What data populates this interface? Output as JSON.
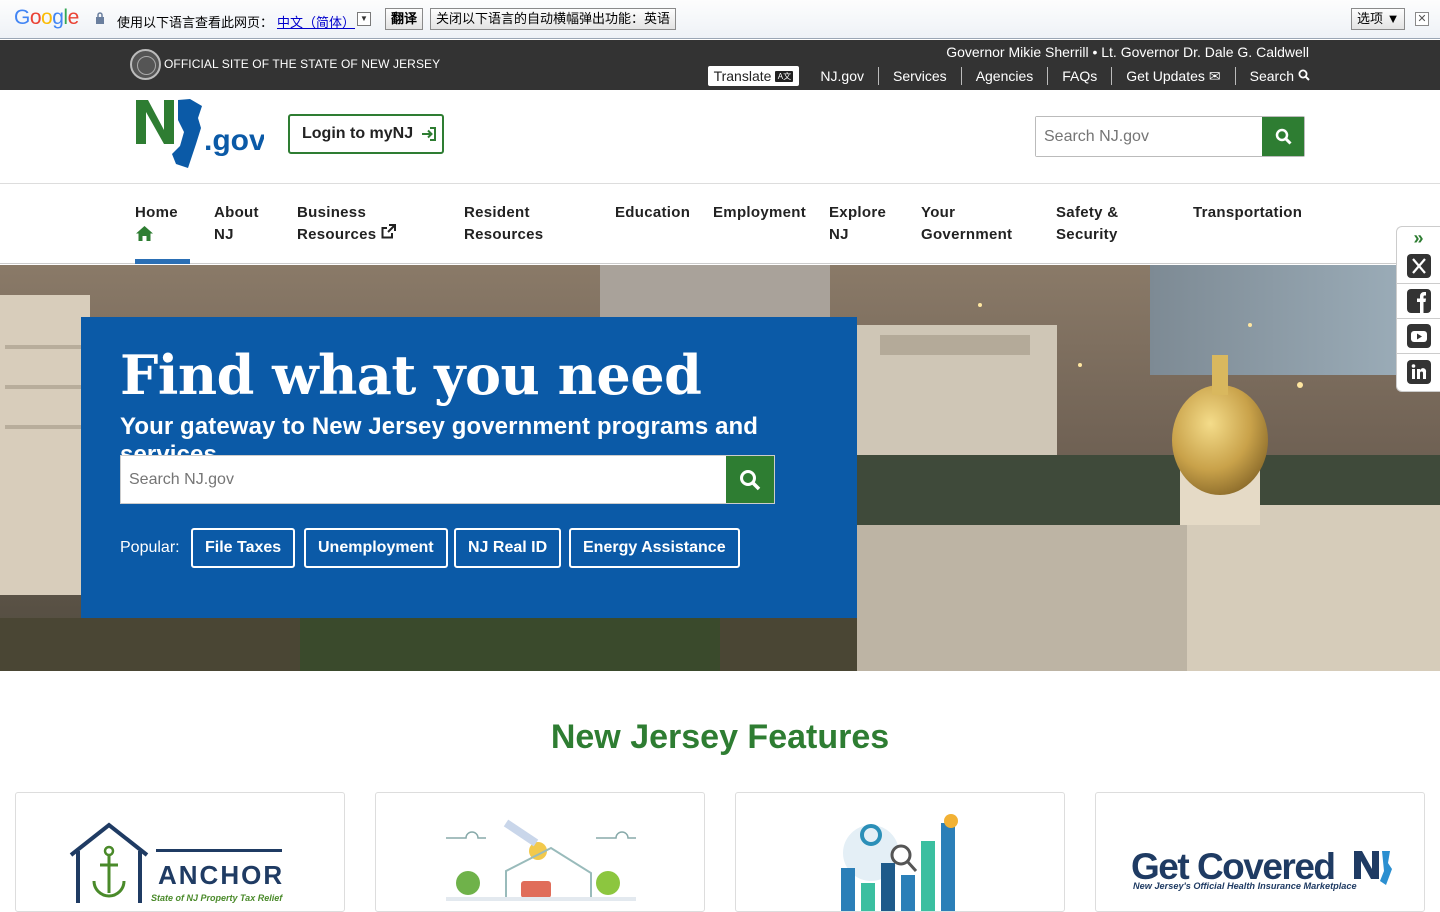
{
  "translate_bar": {
    "logo": "Google",
    "prompt": "使用以下语言查看此网页：",
    "language": "中文（简体）",
    "translate_button": "翻译",
    "disable_button": "关闭以下语言的自动横幅弹出功能：英语",
    "options_button": "选项 ▼"
  },
  "top_strip": {
    "official_text": "OFFICIAL SITE OF THE STATE OF NEW JERSEY",
    "governor_line": "Governor Mikie Sherrill • Lt. Governor Dr. Dale G. Caldwell",
    "translate_label": "Translate",
    "links": [
      "NJ.gov",
      "Services",
      "Agencies",
      "FAQs",
      "Get Updates",
      "Search"
    ]
  },
  "header": {
    "logo_text": ".gov",
    "login_label": "Login to myNJ",
    "search_placeholder": "Search NJ.gov"
  },
  "nav": {
    "items": [
      {
        "line1": "Home",
        "line2": ""
      },
      {
        "line1": "About",
        "line2": "NJ"
      },
      {
        "line1": "Business",
        "line2": "Resources"
      },
      {
        "line1": "Resident",
        "line2": "Resources"
      },
      {
        "line1": "Education",
        "line2": ""
      },
      {
        "line1": "Employment",
        "line2": ""
      },
      {
        "line1": "Explore",
        "line2": "NJ"
      },
      {
        "line1": "Your",
        "line2": "Government"
      },
      {
        "line1": "Safety &",
        "line2": "Security"
      },
      {
        "line1": "Transportation",
        "line2": ""
      }
    ]
  },
  "hero": {
    "title": "Find what you need",
    "subtitle": "Your gateway to New Jersey government programs and services.",
    "search_placeholder": "Search NJ.gov",
    "popular_label": "Popular:",
    "popular": [
      "File Taxes",
      "Unemployment",
      "NJ Real ID",
      "Energy Assistance"
    ]
  },
  "features": {
    "title": "New Jersey Features",
    "anchor_title": "ANCHOR",
    "anchor_subtitle": "State of NJ Property Tax Relief",
    "getcovered_title": "Get Covered",
    "getcovered_subtitle": "New Jersey's Official Health Insurance Marketplace"
  },
  "colors": {
    "green": "#2e7d32",
    "blue": "#0b5aa7",
    "dark": "#333333"
  }
}
